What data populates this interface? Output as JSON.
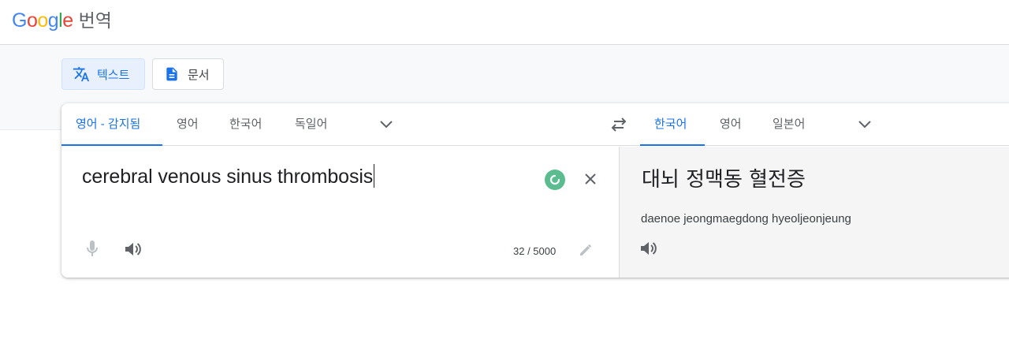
{
  "header": {
    "logo_text": "Google",
    "logo_colors": [
      "#4285F4",
      "#EA4335",
      "#FBBC05",
      "#4285F4",
      "#34A853",
      "#EA4335"
    ],
    "product": "번역"
  },
  "modes": {
    "text_label": "텍스트",
    "document_label": "문서"
  },
  "source": {
    "tabs": [
      "영어 - 감지됨",
      "영어",
      "한국어",
      "독일어"
    ],
    "active_tab": 0,
    "text": "cerebral venous sinus thrombosis",
    "counter": "32 / 5000"
  },
  "target": {
    "tabs": [
      "한국어",
      "영어",
      "일본어"
    ],
    "active_tab": 0,
    "text": "대뇌 정맥동 혈전증",
    "transliteration": "daenoe jeongmaegdong hyeoljeonjeung"
  },
  "colors": {
    "accent": "#1a73e8",
    "loading": "#34A853"
  },
  "icons": {
    "text_mode": "translate-icon",
    "document_mode": "document-icon",
    "expand": "chevron-down-icon",
    "swap": "swap-icon",
    "clear": "close-icon",
    "mic": "mic-icon",
    "speaker": "speaker-icon",
    "edit": "pencil-icon",
    "loading": "loading-icon"
  }
}
